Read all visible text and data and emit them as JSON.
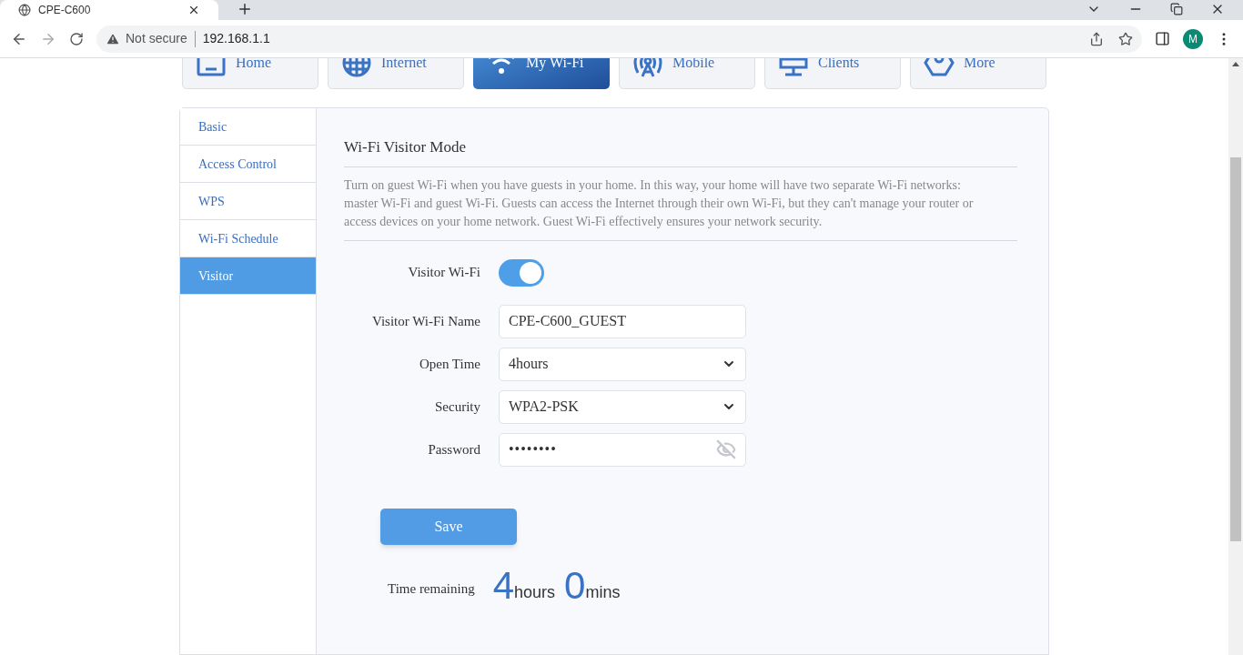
{
  "browser": {
    "tab_title": "CPE-C600",
    "security_label": "Not secure",
    "url": "192.168.1.1",
    "avatar": "M"
  },
  "nav_tabs": [
    {
      "label": "Home",
      "selected": false
    },
    {
      "label": "Internet",
      "selected": false
    },
    {
      "label": "My Wi-Fi",
      "selected": true
    },
    {
      "label": "Mobile",
      "selected": false
    },
    {
      "label": "Clients",
      "selected": false
    },
    {
      "label": "More",
      "selected": false
    }
  ],
  "sidebar": {
    "items": [
      {
        "label": "Basic",
        "selected": false
      },
      {
        "label": "Access Control",
        "selected": false
      },
      {
        "label": "WPS",
        "selected": false
      },
      {
        "label": "Wi-Fi Schedule",
        "selected": false
      },
      {
        "label": "Visitor",
        "selected": true
      }
    ]
  },
  "section": {
    "title": "Wi-Fi Visitor Mode",
    "description": "Turn on guest Wi-Fi when you have guests in your home. In this way, your home will have two separate Wi-Fi networks: master Wi-Fi and guest Wi-Fi. Guests can access the Internet through their own Wi-Fi, but they can't manage your router or access devices on your home network. Guest Wi-Fi effectively ensures your network security."
  },
  "form": {
    "fields": [
      {
        "kind": "toggle",
        "label": "Visitor Wi-Fi",
        "on": true
      },
      {
        "kind": "text",
        "label": "Visitor Wi-Fi Name",
        "value": "CPE-C600_GUEST"
      },
      {
        "kind": "select",
        "label": "Open Time",
        "value": "4hours"
      },
      {
        "kind": "select",
        "label": "Security",
        "value": "WPA2-PSK"
      },
      {
        "kind": "password",
        "label": "Password",
        "value": "••••••••"
      }
    ],
    "save_button": "Save"
  },
  "time_remaining": {
    "label": "Time remaining",
    "hours": "4",
    "hours_unit": "hours",
    "mins": "0",
    "mins_unit": "mins"
  }
}
